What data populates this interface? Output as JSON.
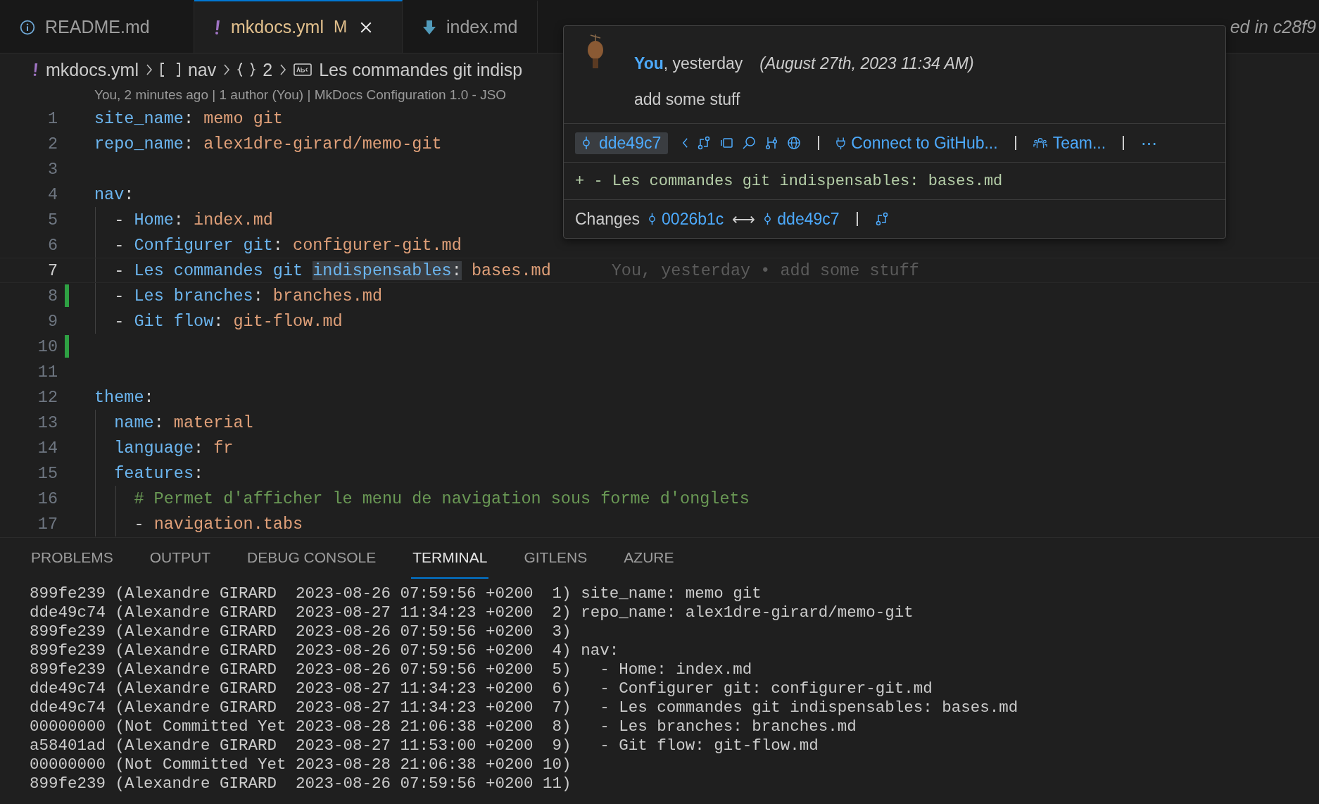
{
  "tabs": [
    {
      "label": "README.md",
      "kind": "info",
      "selected": false
    },
    {
      "label": "mkdocs.yml",
      "kind": "config",
      "selected": true,
      "badge": "M"
    },
    {
      "label": "index.md",
      "kind": "markdown",
      "selected": false
    },
    {
      "label": "ed in c28f9",
      "kind": "preview",
      "selected": false
    }
  ],
  "breadcrumb": [
    {
      "kind": "file",
      "label": "mkdocs.yml"
    },
    {
      "kind": "array",
      "label": "nav"
    },
    {
      "kind": "object",
      "label": "2"
    },
    {
      "kind": "string",
      "label": "Les commandes git indisp"
    }
  ],
  "codelens": "You, 2 minutes ago | 1 author (You) | MkDocs Configuration 1.0 - JSO",
  "lines": [
    {
      "number": "1",
      "current": false,
      "added": false,
      "tokens": [
        {
          "kind": "key",
          "text": "site_name"
        },
        {
          "kind": "punct",
          "text": ":"
        },
        {
          "kind": "value",
          "text": " memo git"
        }
      ]
    },
    {
      "number": "2",
      "current": false,
      "added": false,
      "tokens": [
        {
          "kind": "key",
          "text": "repo_name"
        },
        {
          "kind": "punct",
          "text": ":"
        },
        {
          "kind": "value",
          "text": " alex1dre-girard/memo-git"
        }
      ]
    },
    {
      "number": "3",
      "current": false,
      "added": false
    },
    {
      "number": "4",
      "current": false,
      "added": false,
      "tokens": [
        {
          "kind": "key",
          "text": "nav"
        },
        {
          "kind": "punct",
          "text": ":"
        }
      ],
      "children": [
        {
          "number": "5",
          "current": false,
          "added": false,
          "tokens": [
            {
              "kind": "punct",
              "text": "- "
            },
            {
              "kind": "key",
              "text": "Home"
            },
            {
              "kind": "punct",
              "text": ":"
            },
            {
              "kind": "value",
              "text": " index.md"
            }
          ]
        },
        {
          "number": "6",
          "current": false,
          "added": false,
          "tokens": [
            {
              "kind": "punct",
              "text": "- "
            },
            {
              "kind": "key",
              "text": "Configurer git"
            },
            {
              "kind": "punct",
              "text": ":"
            },
            {
              "kind": "value",
              "text": " configurer-git.md"
            }
          ]
        },
        {
          "number": "7",
          "current": true,
          "added": false,
          "blame": "You, yesterday • add some stuff",
          "tokens": [
            {
              "kind": "punct",
              "text": "- ",
              "highlighted": false
            },
            {
              "kind": "key",
              "text": "Les commandes git ",
              "highlighted": false
            },
            {
              "kind": "key",
              "text": "indispensables",
              "highlighted": true
            },
            {
              "kind": "punct",
              "text": ":",
              "highlighted": true
            },
            {
              "kind": "value",
              "text": " bases.md",
              "highlighted": false
            }
          ]
        },
        {
          "number": "8",
          "current": false,
          "added": true,
          "tokens": [
            {
              "kind": "punct",
              "text": "- "
            },
            {
              "kind": "key",
              "text": "Les branches"
            },
            {
              "kind": "punct",
              "text": ":"
            },
            {
              "kind": "value",
              "text": " branches.md"
            }
          ]
        },
        {
          "number": "9",
          "current": false,
          "added": false,
          "tokens": [
            {
              "kind": "punct",
              "text": "- "
            },
            {
              "kind": "key",
              "text": "Git flow"
            },
            {
              "kind": "punct",
              "text": ":"
            },
            {
              "kind": "value",
              "text": " git-flow.md"
            }
          ]
        }
      ]
    },
    {
      "number": "10",
      "current": false,
      "added": true
    },
    {
      "number": "11",
      "current": false,
      "added": false
    },
    {
      "number": "12",
      "current": false,
      "added": false,
      "tokens": [
        {
          "kind": "key",
          "text": "theme"
        },
        {
          "kind": "punct",
          "text": ":"
        }
      ],
      "children": [
        {
          "number": "13",
          "current": false,
          "added": false,
          "tokens": [
            {
              "kind": "key",
              "text": "name"
            },
            {
              "kind": "punct",
              "text": ":"
            },
            {
              "kind": "value",
              "text": " material"
            }
          ]
        },
        {
          "number": "14",
          "current": false,
          "added": false,
          "tokens": [
            {
              "kind": "key",
              "text": "language"
            },
            {
              "kind": "punct",
              "text": ":"
            },
            {
              "kind": "value",
              "text": " fr"
            }
          ]
        },
        {
          "number": "15",
          "current": false,
          "added": false,
          "tokens": [
            {
              "kind": "key",
              "text": "features"
            },
            {
              "kind": "punct",
              "text": ":"
            }
          ],
          "children": [
            {
              "number": "16",
              "current": false,
              "added": false,
              "tokens": [
                {
                  "kind": "comment",
                  "text": "# Permet d'afficher le menu de navigation sous forme d'onglets"
                }
              ]
            },
            {
              "number": "17",
              "current": false,
              "added": false,
              "tokens": [
                {
                  "kind": "punct",
                  "text": "- "
                },
                {
                  "kind": "value",
                  "text": "navigation.tabs"
                }
              ]
            }
          ]
        }
      ]
    }
  ],
  "hover": {
    "author": "You",
    "when": ", yesterday",
    "date": "(August 27th, 2023 11:34 AM)",
    "message": "add some stuff",
    "sha": "dde49c7",
    "connect": "Connect to GitHub...",
    "team": "Team...",
    "more": "⋯",
    "diff": "+ - Les commandes git indispensables: bases.md",
    "changes_label": "Changes",
    "from_sha": "0026b1c",
    "arrow": "⟷",
    "to_sha": "dde49c7"
  },
  "panel_tabs": [
    {
      "label": "PROBLEMS",
      "selected": false
    },
    {
      "label": "OUTPUT",
      "selected": false
    },
    {
      "label": "DEBUG CONSOLE",
      "selected": false
    },
    {
      "label": "TERMINAL",
      "selected": true
    },
    {
      "label": "GITLENS",
      "selected": false
    },
    {
      "label": "AZURE",
      "selected": false
    }
  ],
  "terminal": [
    "899fe239 (Alexandre GIRARD  2023-08-26 07:59:56 +0200  1) site_name: memo git",
    "dde49c74 (Alexandre GIRARD  2023-08-27 11:34:23 +0200  2) repo_name: alex1dre-girard/memo-git",
    "899fe239 (Alexandre GIRARD  2023-08-26 07:59:56 +0200  3)",
    "899fe239 (Alexandre GIRARD  2023-08-26 07:59:56 +0200  4) nav:",
    "899fe239 (Alexandre GIRARD  2023-08-26 07:59:56 +0200  5)   - Home: index.md",
    "dde49c74 (Alexandre GIRARD  2023-08-27 11:34:23 +0200  6)   - Configurer git: configurer-git.md",
    "dde49c74 (Alexandre GIRARD  2023-08-27 11:34:23 +0200  7)   - Les commandes git indispensables: bases.md",
    "00000000 (Not Committed Yet 2023-08-28 21:06:38 +0200  8)   - Les branches: branches.md",
    "a58401ad (Alexandre GIRARD  2023-08-27 11:53:00 +0200  9)   - Git flow: git-flow.md",
    "00000000 (Not Committed Yet 2023-08-28 21:06:38 +0200 10)",
    "899fe239 (Alexandre GIRARD  2023-08-26 07:59:56 +0200 11)"
  ]
}
